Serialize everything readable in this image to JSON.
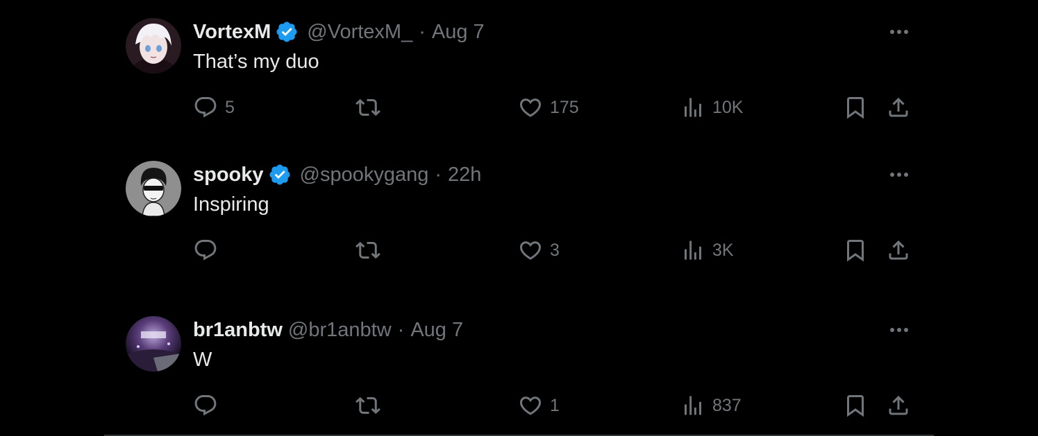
{
  "colors": {
    "background": "#000000",
    "primary_text": "#e7e9ea",
    "secondary_text": "#71767b",
    "verified_blue": "#1d9bf0"
  },
  "tweets": [
    {
      "display_name": "VortexM",
      "verified": true,
      "handle": "@VortexM_",
      "separator": "·",
      "time": "Aug 7",
      "text": "That’s my duo",
      "replies": "5",
      "retweets": "",
      "likes": "175",
      "views": "10K"
    },
    {
      "display_name": "spooky",
      "verified": true,
      "handle": "@spookygang",
      "separator": "·",
      "time": "22h",
      "text": "Inspiring",
      "replies": "",
      "retweets": "",
      "likes": "3",
      "views": "3K"
    },
    {
      "display_name": "br1anbtw",
      "verified": false,
      "handle": "@br1anbtw",
      "separator": "·",
      "time": "Aug 7",
      "text": "W",
      "replies": "",
      "retweets": "",
      "likes": "1",
      "views": "837"
    }
  ],
  "icons": {
    "reply": "reply-icon",
    "retweet": "retweet-icon",
    "like": "heart-icon",
    "views": "views-icon",
    "bookmark": "bookmark-icon",
    "share": "share-icon",
    "more": "more-icon",
    "verified": "verified-badge-icon"
  }
}
